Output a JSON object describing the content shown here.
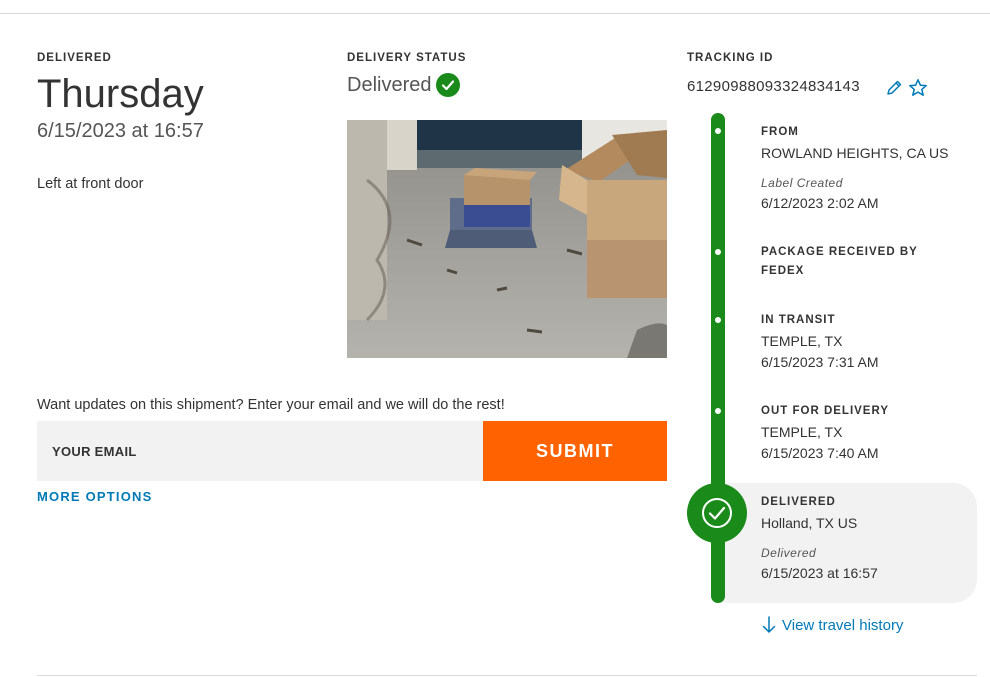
{
  "delivered": {
    "label": "DELIVERED",
    "day": "Thursday",
    "datetime": "6/15/2023 at 16:57",
    "note": "Left at front door"
  },
  "delivery_status": {
    "label": "DELIVERY STATUS",
    "value": "Delivered",
    "icon": "check-circle-icon"
  },
  "photo": {
    "icon": "delivery-photo"
  },
  "updates": {
    "prompt": "Want updates on this shipment? Enter your email and we will do the rest!",
    "email_placeholder": "YOUR EMAIL",
    "email_value": "",
    "submit_label": "SUBMIT",
    "more_options": "MORE OPTIONS"
  },
  "tracking": {
    "label": "TRACKING ID",
    "number": "612909880933248341​43",
    "icons": [
      "pencil-icon",
      "star-icon"
    ]
  },
  "timeline": [
    {
      "title": "FROM",
      "location": "ROWLAND HEIGHTS, CA US",
      "sub": "Label Created",
      "time": "6/12/2023 2:02 AM"
    },
    {
      "title_line1": "PACKAGE RECEIVED BY",
      "title_line2": "FEDEX"
    },
    {
      "title": "IN TRANSIT",
      "location": "TEMPLE, TX",
      "time": "6/15/2023 7:31 AM"
    },
    {
      "title": "OUT FOR DELIVERY",
      "location": "TEMPLE, TX",
      "time": "6/15/2023 7:40 AM"
    },
    {
      "title": "DELIVERED",
      "location": "Holland, TX US",
      "sub": "Delivered",
      "time": "6/15/2023 at 16:57"
    }
  ],
  "view_history": "View travel history",
  "colors": {
    "accent_green": "#1a8a1a",
    "submit_orange": "#ff6200",
    "link_blue": "#007ab7",
    "field_gray": "#f2f2f2"
  }
}
